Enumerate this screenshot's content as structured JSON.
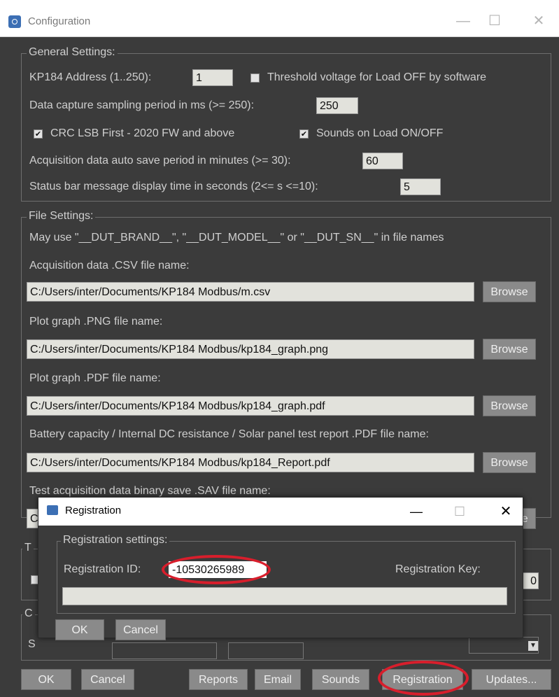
{
  "window": {
    "title": "Configuration",
    "minimize": "—",
    "maximize": "☐",
    "close": "✕"
  },
  "general": {
    "legend": "General Settings:",
    "kp184_address_label": "KP184 Address (1..250):",
    "kp184_address_value": "1",
    "threshold_label": "Threshold voltage for Load OFF by software",
    "threshold_checked": false,
    "sampling_label": "Data capture sampling period in ms (>= 250):",
    "sampling_value": "250",
    "crc_label": "CRC LSB First - 2020 FW and above",
    "crc_checked": true,
    "sounds_label": "Sounds on Load ON/OFF",
    "sounds_checked": true,
    "autosave_label": "Acquisition data auto save period in minutes (>= 30):",
    "autosave_value": "60",
    "statusbar_label": "Status bar message display time in seconds (2<= s <=10):",
    "statusbar_value": "5"
  },
  "files": {
    "legend": "File Settings:",
    "hint": "May use \"__DUT_BRAND__\", \"__DUT_MODEL__\" or \"__DUT_SN__\" in file names",
    "csv_label": "Acquisition data .CSV file name:",
    "csv_value": "C:/Users/inter/Documents/KP184 Modbus/m.csv",
    "png_label": "Plot graph .PNG file name:",
    "png_value": "C:/Users/inter/Documents/KP184 Modbus/kp184_graph.png",
    "pdf_label": "Plot graph .PDF file name:",
    "pdf_value": "C:/Users/inter/Documents/KP184 Modbus/kp184_graph.pdf",
    "report_label": "Battery capacity / Internal DC resistance / Solar panel test report .PDF file name:",
    "report_value": "C:/Users/inter/Documents/KP184 Modbus/kp184_Report.pdf",
    "sav_label": "Test acquisition data binary save .SAV file name:",
    "sav_value": "C",
    "browse_label": "Browse"
  },
  "partial": {
    "t_legend": "T",
    "c_legend": "C",
    "s_label": "S",
    "right_value": "0"
  },
  "registration": {
    "title": "Registration",
    "minimize": "—",
    "maximize": "☐",
    "close": "✕",
    "legend": "Registration settings:",
    "id_label": "Registration ID:",
    "id_value": "-10530265989",
    "key_label": "Registration Key:",
    "key_value": "",
    "ok_label": "OK",
    "cancel_label": "Cancel"
  },
  "bottom_buttons": {
    "ok": "OK",
    "cancel": "Cancel",
    "reports": "Reports",
    "email": "Email",
    "sounds": "Sounds",
    "registration": "Registration",
    "updates": "Updates..."
  },
  "colors": {
    "background": "#3b3b3b",
    "button": "#8a8a8a",
    "textbox": "#e2e2dc",
    "highlight_ellipse": "#d81e2c"
  }
}
